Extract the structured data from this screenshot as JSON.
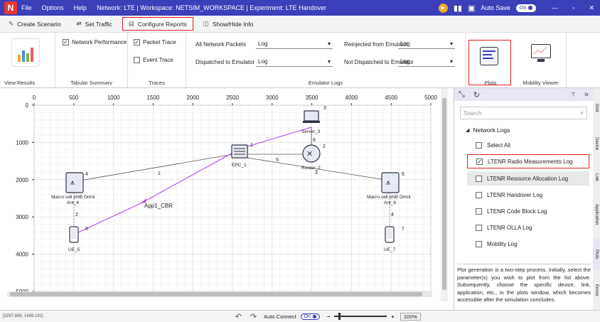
{
  "titlebar": {
    "menu": [
      "File",
      "Options",
      "Help"
    ],
    "title": "Network: LTE | Workspace: NETSIM_WORKSPACE | Experiment: LTE Handover",
    "auto_save_label": "Auto Save",
    "auto_save_state": "On"
  },
  "ribbon_tabs": [
    {
      "label": "Create Scenario",
      "icon": "scenario-icon"
    },
    {
      "label": "Set Traffic",
      "icon": "traffic-icon"
    },
    {
      "label": "Configure Reports",
      "icon": "report-icon",
      "active": true
    },
    {
      "label": "Show/Hide Info",
      "icon": "info-icon"
    }
  ],
  "ribbon": {
    "view_results": "View Results",
    "network_performance": "Network Performance",
    "tabular_summary": "Tabular Summary",
    "packet_trace": "Packet Trace",
    "event_trace": "Event Trace",
    "traces": "Traces",
    "all_network_packets_label": "All Network Packets",
    "all_network_packets_value": "Log",
    "dispatched_label": "Dispatched to Emulator",
    "dispatched_value": "Log",
    "reinjected_label": "Reinjected from Emulator",
    "reinjected_value": "Log",
    "not_dispatched_label": "Not Dispatched to Emulator",
    "not_dispatched_value": "Log",
    "emulator_logs": "Emulator Logs",
    "plots": "Plots",
    "mobility_viewer": "Mobility Viewer"
  },
  "canvas": {
    "x_ticks": [
      "0",
      "500",
      "1000",
      "1500",
      "2000",
      "2500",
      "3000",
      "3500",
      "4000",
      "4500",
      "5000"
    ],
    "y_ticks": [
      "0",
      "1000",
      "2000",
      "3000",
      "4000",
      "5000"
    ],
    "nodes": {
      "server": {
        "name": "Server_3",
        "id": "3"
      },
      "epc": {
        "name": "EPC_1",
        "id": "1"
      },
      "router": {
        "name": "Router_2",
        "id": "2"
      },
      "enb_left": {
        "name": "Macro cell eNB Omni Ant_4",
        "line1": "Macro cell eNB Omni",
        "line2": "Ant_4",
        "id": "4"
      },
      "enb_right": {
        "name": "Macro cell eNB Omni Ant_6",
        "line1": "Macro cell eNB Omni",
        "line2": "Ant_6",
        "id": "6"
      },
      "ue_left": {
        "name": "UE_5",
        "id": "5"
      },
      "ue_right": {
        "name": "UE_7",
        "id": "7"
      }
    },
    "link_labels": {
      "l1": "1",
      "l2": "2",
      "l3": "3",
      "l4": "4",
      "l5": "5",
      "l6": "6",
      "l8": "8"
    },
    "app_label": "App1_CBR"
  },
  "panel": {
    "search_placeholder": "Search",
    "group_title": "Network Logs",
    "select_all": "Select All",
    "logs": [
      {
        "label": "LTENR Radio Measurements Log",
        "checked": true
      },
      {
        "label": "LTENR Resource Allocation Log",
        "checked": false
      },
      {
        "label": "LTENR Handover Log",
        "checked": false
      },
      {
        "label": "LTENR Code Block Log",
        "checked": false
      },
      {
        "label": "LTENR OLLA Log",
        "checked": false
      },
      {
        "label": "Mobility Log",
        "checked": false
      }
    ],
    "help_text": "Plot generation is a two-step process. Initially, select the parameter(s) you wish to plot from the list above. Subsequently, choose the specific device, link, application, etc., in the plots window, which becomes accessible after the simulation concludes."
  },
  "side_tabs": [
    "Grid",
    "Device",
    "Link",
    "Application",
    "Plots",
    "Errors"
  ],
  "status": {
    "coords": "[3297.866, 1469.191]",
    "auto_connect": "Auto Connect",
    "auto_connect_state": "On",
    "zoom": "100%"
  },
  "colors": {
    "accent": "#3b3fb8",
    "highlight": "#e02020",
    "app_link": "#b040f0"
  }
}
